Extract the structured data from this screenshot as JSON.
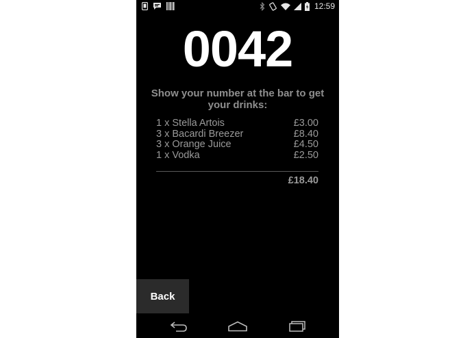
{
  "status_bar": {
    "time": "12:59",
    "left_icons": [
      "android-debug-icon",
      "chat-icon",
      "barcode-icon"
    ],
    "right_icons": [
      "bluetooth-icon",
      "rotation-icon",
      "wifi-icon",
      "signal-icon",
      "battery-icon"
    ]
  },
  "order": {
    "number": "0042",
    "instructions": "Show your number at the bar to get your drinks:",
    "items": [
      {
        "description": "1 x Stella Artois",
        "price": "£3.00"
      },
      {
        "description": "3 x Bacardi Breezer",
        "price": "£8.40"
      },
      {
        "description": "3 x Orange Juice",
        "price": "£4.50"
      },
      {
        "description": "1 x Vodka",
        "price": "£2.50"
      }
    ],
    "total": "£18.40"
  },
  "actions": {
    "back_label": "Back"
  },
  "nav_bar": {
    "icons": [
      "back-icon",
      "home-icon",
      "recents-icon"
    ]
  },
  "colors": {
    "background": "#000000",
    "number": "#ffffff",
    "secondary_text": "#9a9a9a",
    "button_bg": "#2b2b2b"
  }
}
